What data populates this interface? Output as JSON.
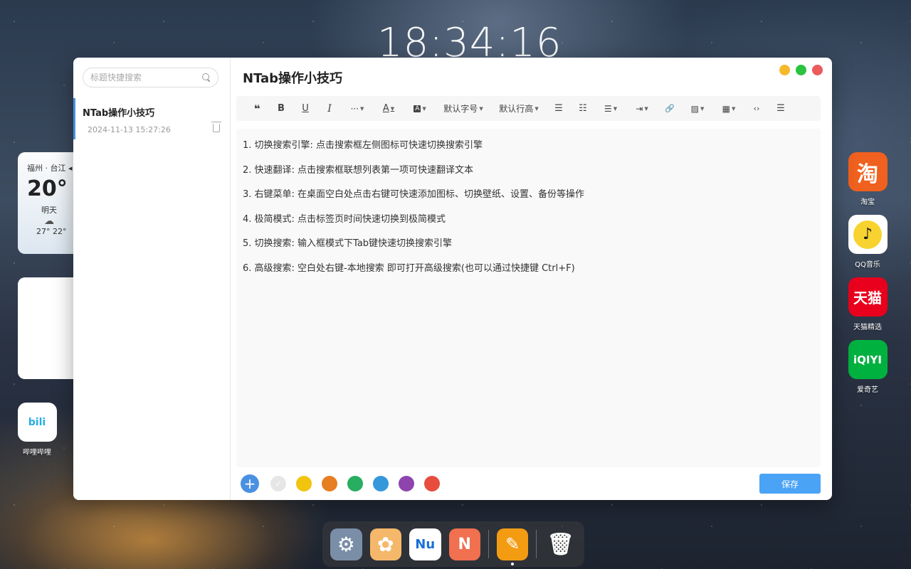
{
  "clock": {
    "time": "18:34:16"
  },
  "weather": {
    "city": "福州 · 台江 ◂",
    "temp": "20°",
    "day": "明天",
    "range": "27° 22°"
  },
  "desktop_icons": [
    {
      "label": "淘宝",
      "glyph": "淘",
      "color": "#f0601e"
    },
    {
      "label": "QQ音乐",
      "glyph": "♪",
      "color": "#ffffff"
    },
    {
      "label": "天猫精选",
      "glyph": "天猫",
      "color": "#e8001c"
    },
    {
      "label": "爱奇艺",
      "glyph": "iQIYI",
      "color": "#00b140"
    },
    {
      "label": "哔哩哔哩",
      "glyph": "bili",
      "color": "#ffffff"
    }
  ],
  "sidebar": {
    "search_placeholder": "标题快捷搜索",
    "notes": [
      {
        "title": "NTab操作小技巧",
        "date": "2024-11-13 15:27:26"
      }
    ]
  },
  "editor": {
    "title": "NTab操作小技巧",
    "toolbar": {
      "quote": "❝",
      "bold": "B",
      "underline": "U",
      "italic": "I",
      "more": "···",
      "font_color": "A",
      "bg_color": "A",
      "font_size": "默认字号",
      "line_height": "默认行高",
      "ul": "☰",
      "ol": "☷",
      "align": "☰",
      "indent": "⇥",
      "link": "🔗",
      "image": "▨",
      "table": "▦",
      "code": "‹›",
      "hr": "☰"
    },
    "lines": [
      "1. 切换搜索引擎: 点击搜索框左侧图标可快速切换搜索引擎",
      "2. 快速翻译: 点击搜索框联想列表第一项可快速翻译文本",
      "3. 右键菜单: 在桌面空白处点击右键可快速添加图标、切换壁纸、设置、备份等操作",
      "4. 极简模式: 点击标签页时间快速切换到极简模式",
      "5. 切换搜索: 输入框模式下Tab键快速切换搜索引擎",
      "6. 高级搜索: 空白处右键-本地搜索 即可打开高级搜索(也可以通过快捷键 Ctrl+F)"
    ],
    "add_label": "+",
    "note_colors": [
      "#e6e6e6",
      "#f1c40f",
      "#e67e22",
      "#27ae60",
      "#3498db",
      "#8e44ad",
      "#e74c3c"
    ],
    "save_label": "保存"
  },
  "window_controls": {
    "minimize_color": "#f5b92c",
    "maximize_color": "#2bc23f",
    "close_color": "#ed5b5b"
  },
  "dock": [
    {
      "name": "settings",
      "glyph": "⚙",
      "color": "#7a8ea8"
    },
    {
      "name": "flower",
      "glyph": "✿",
      "color": "#f5b86a"
    },
    {
      "name": "nu",
      "glyph": "Nu",
      "color": "#ffffff"
    },
    {
      "name": "n-app",
      "glyph": "N",
      "color": "#f07050"
    },
    {
      "name": "notes",
      "glyph": "✎",
      "color": "#f39c12"
    },
    {
      "name": "trash",
      "glyph": "🗑",
      "color": "#e8e8e8"
    }
  ]
}
